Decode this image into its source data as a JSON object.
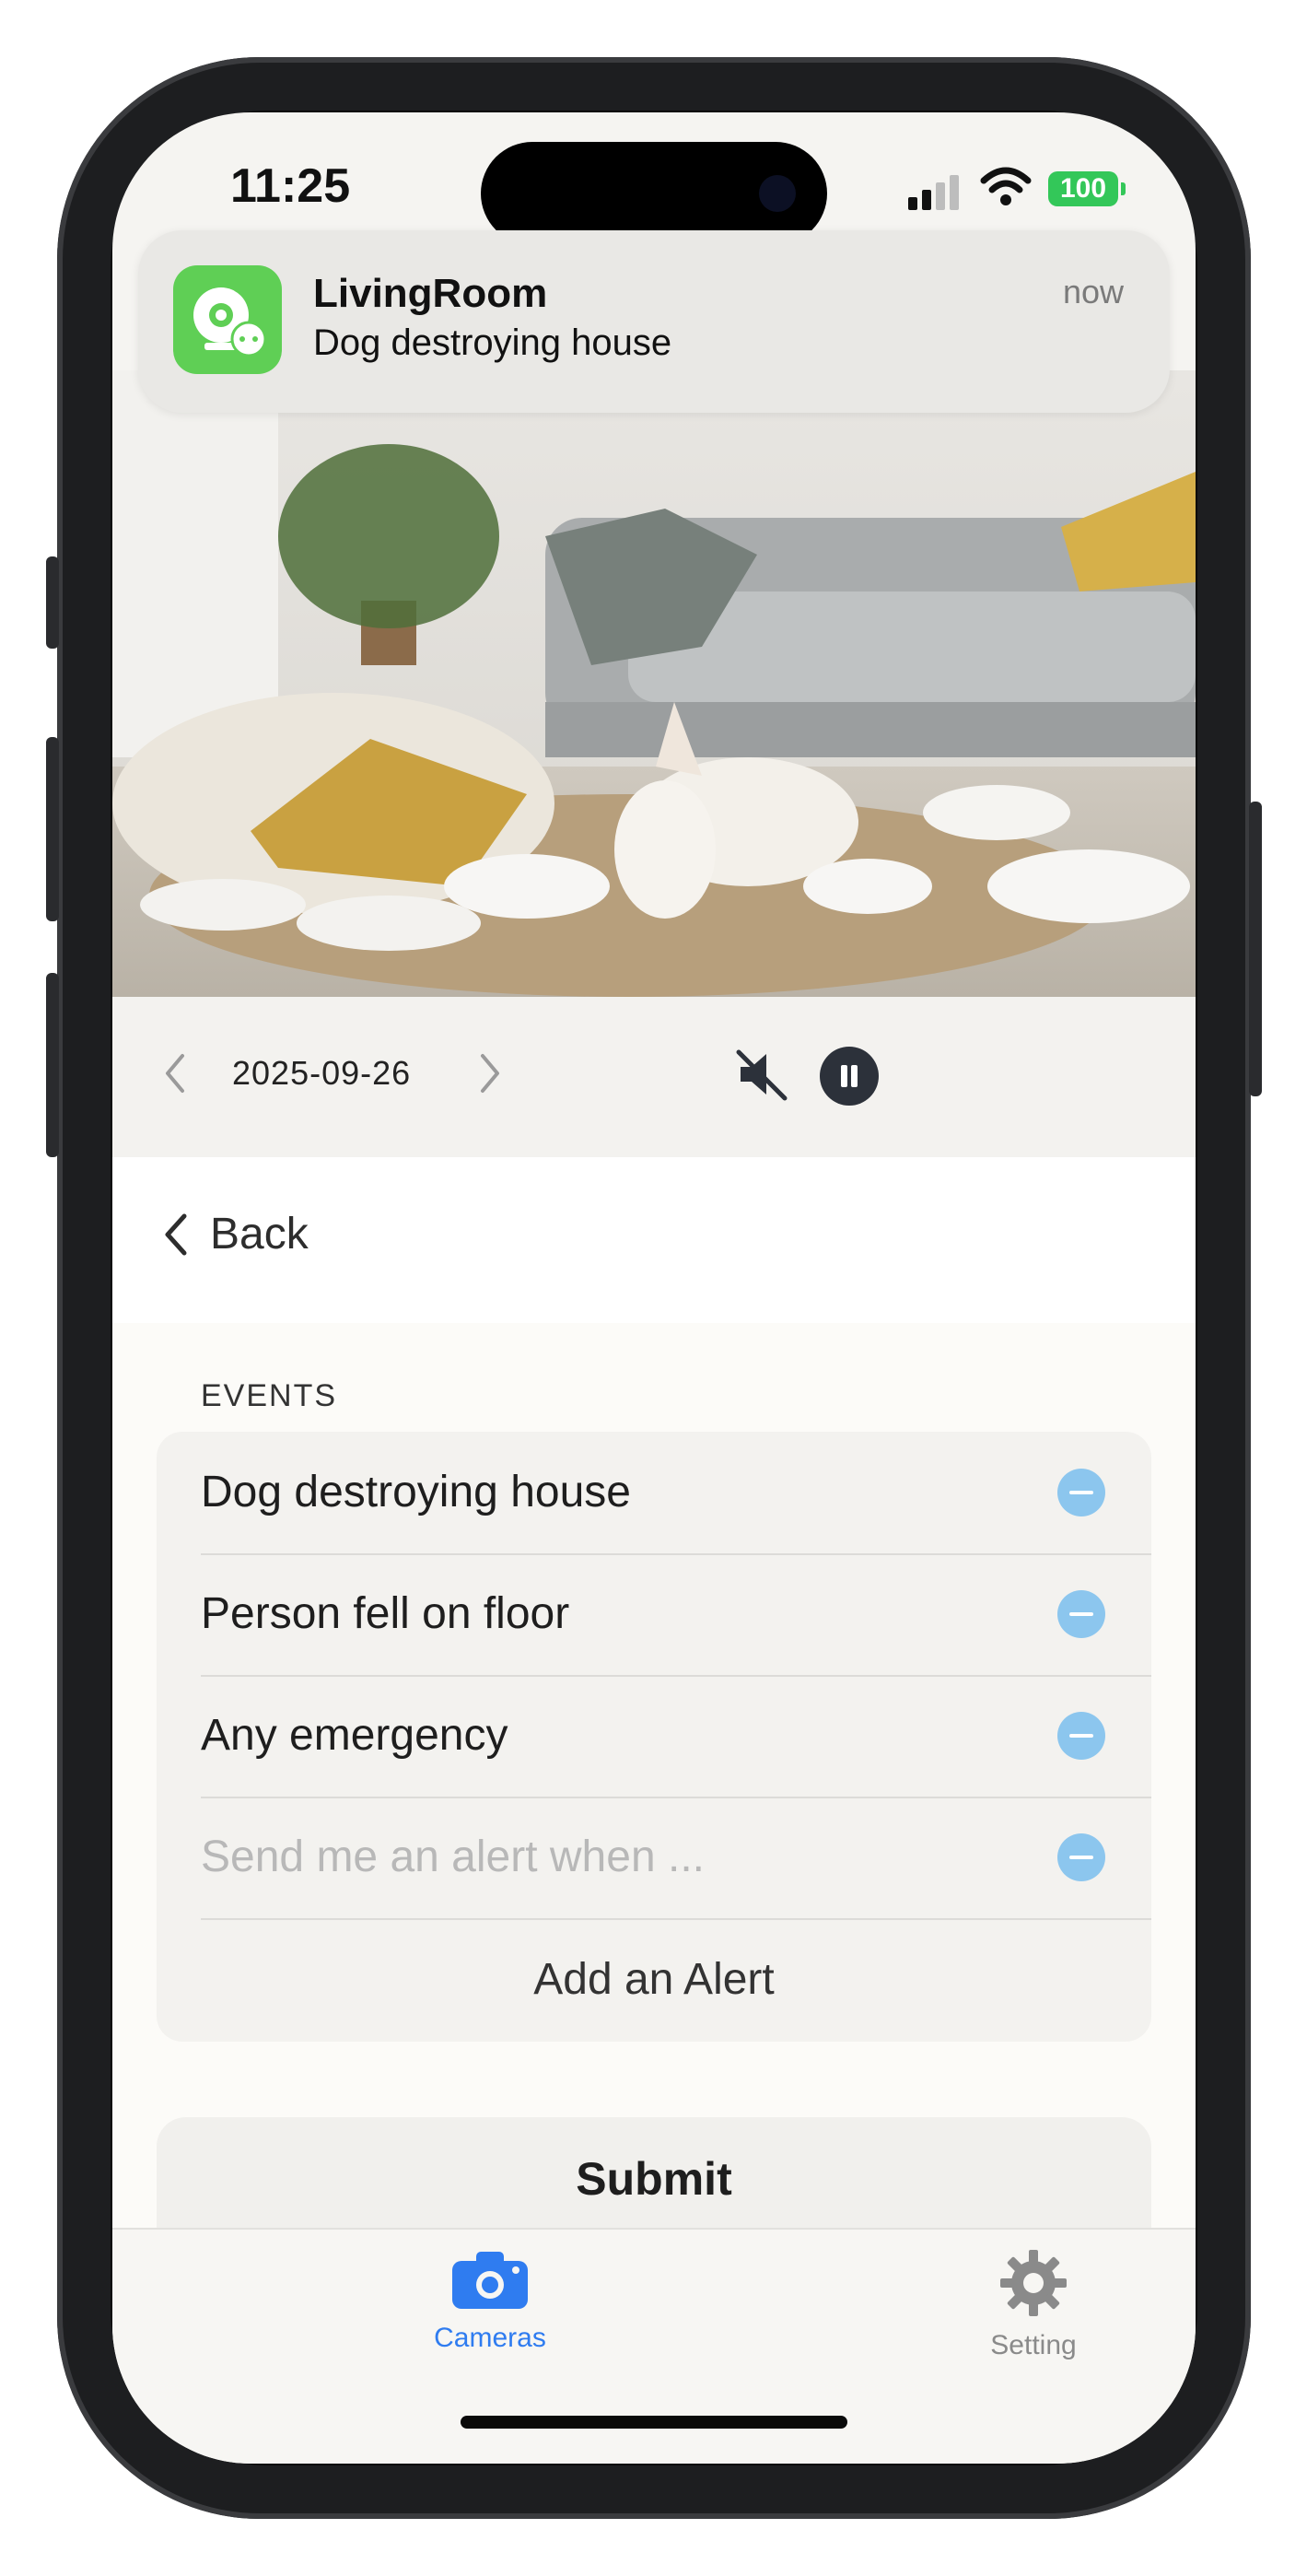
{
  "status_bar": {
    "time": "11:25",
    "battery": "100"
  },
  "notification": {
    "app_name": "LivingRoom",
    "message": "Dog destroying house",
    "time": "now"
  },
  "playback": {
    "date": "2025-09-26"
  },
  "nav": {
    "back_label": "Back"
  },
  "events": {
    "section_title": "EVENTS",
    "items": [
      {
        "label": "Dog destroying house"
      },
      {
        "label": "Person fell on floor"
      },
      {
        "label": "Any emergency"
      }
    ],
    "new_alert_placeholder": "Send me an alert when ...",
    "add_label": "Add an Alert"
  },
  "submit_label": "Submit",
  "tabbar": {
    "tabs": [
      {
        "label": "Cameras",
        "icon": "camera-icon",
        "active": true
      },
      {
        "label": "Setting",
        "icon": "gear-icon",
        "active": false
      }
    ]
  },
  "colors": {
    "accent": "#2f7cf0",
    "battery": "#33c759",
    "app_icon": "#5fcf55",
    "remove_button": "#8cc6ee"
  }
}
